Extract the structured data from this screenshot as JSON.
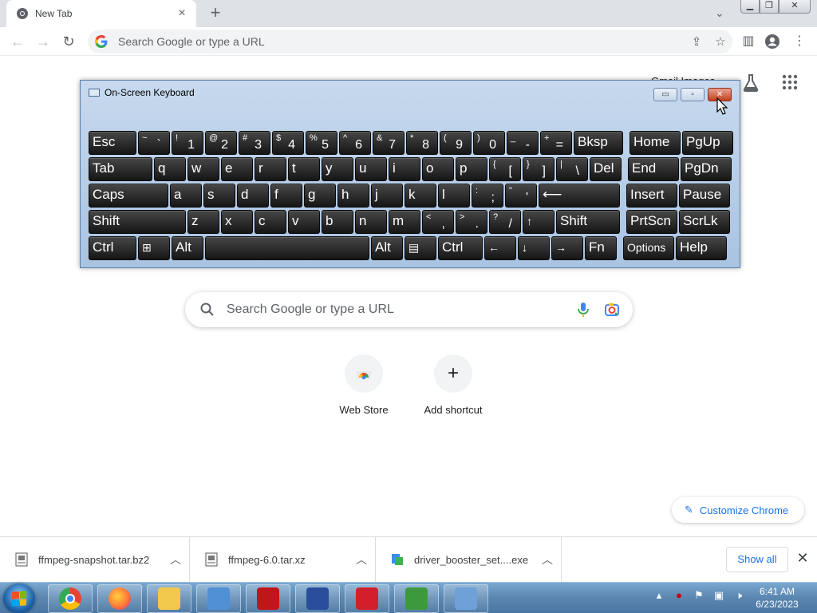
{
  "browser": {
    "tab": {
      "title": "New Tab",
      "close": "×"
    },
    "new_tab": "+",
    "tab_search": "⌄",
    "window_controls": {
      "minimize": "▁",
      "maximize": "❐",
      "close": "✕"
    },
    "nav": {
      "back": "←",
      "forward": "→",
      "reload": "↻"
    },
    "omnibox": {
      "placeholder": "Search Google or type a URL"
    }
  },
  "page": {
    "header_partial": "Gmail  Images",
    "search": {
      "placeholder": "Search Google or type a URL"
    },
    "shortcuts": [
      {
        "label": "Web Store"
      },
      {
        "label": "Add shortcut",
        "icon": "+"
      }
    ],
    "customize_label": "Customize Chrome"
  },
  "osk": {
    "title": "On-Screen Keyboard",
    "buttons": {
      "minimize": "▭",
      "restore": "▫",
      "close": "✕"
    },
    "rows": [
      [
        {
          "label": "Esc",
          "w": 60
        },
        {
          "top": "~",
          "bottom": "`",
          "w": 40
        },
        {
          "top": "!",
          "bottom": "1",
          "w": 40
        },
        {
          "top": "@",
          "bottom": "2",
          "w": 40
        },
        {
          "top": "#",
          "bottom": "3",
          "w": 40
        },
        {
          "top": "$",
          "bottom": "4",
          "w": 40
        },
        {
          "top": "%",
          "bottom": "5",
          "w": 40
        },
        {
          "top": "^",
          "bottom": "6",
          "w": 40
        },
        {
          "top": "&",
          "bottom": "7",
          "w": 40
        },
        {
          "top": "*",
          "bottom": "8",
          "w": 40
        },
        {
          "top": "(",
          "bottom": "9",
          "w": 40
        },
        {
          "top": ")",
          "bottom": "0",
          "w": 40
        },
        {
          "top": "_",
          "bottom": "-",
          "w": 40
        },
        {
          "top": "+",
          "bottom": "=",
          "w": 40
        },
        {
          "label": "Bksp",
          "w": 62,
          "gapAfter": 6
        },
        {
          "label": "Home",
          "w": 64
        },
        {
          "label": "PgUp",
          "w": 64
        }
      ],
      [
        {
          "label": "Tab",
          "w": 80
        },
        {
          "label": "q",
          "w": 40
        },
        {
          "label": "w",
          "w": 40
        },
        {
          "label": "e",
          "w": 40
        },
        {
          "label": "r",
          "w": 40
        },
        {
          "label": "t",
          "w": 40
        },
        {
          "label": "y",
          "w": 40
        },
        {
          "label": "u",
          "w": 40
        },
        {
          "label": "i",
          "w": 40
        },
        {
          "label": "o",
          "w": 40
        },
        {
          "label": "p",
          "w": 40
        },
        {
          "top": "{",
          "bottom": "[",
          "w": 40
        },
        {
          "top": "}",
          "bottom": "]",
          "w": 40
        },
        {
          "top": "|",
          "bottom": "\\",
          "w": 40
        },
        {
          "label": "Del",
          "w": 40,
          "gapAfter": 6
        },
        {
          "label": "End",
          "w": 64
        },
        {
          "label": "PgDn",
          "w": 64
        }
      ],
      [
        {
          "label": "Caps",
          "w": 100
        },
        {
          "label": "a",
          "w": 40
        },
        {
          "label": "s",
          "w": 40
        },
        {
          "label": "d",
          "w": 40
        },
        {
          "label": "f",
          "w": 40
        },
        {
          "label": "g",
          "w": 40
        },
        {
          "label": "h",
          "w": 40
        },
        {
          "label": "j",
          "w": 40
        },
        {
          "label": "k",
          "w": 40
        },
        {
          "label": "l",
          "w": 40
        },
        {
          "top": ":",
          "bottom": ";",
          "w": 40
        },
        {
          "top": "\"",
          "bottom": "'",
          "w": 40
        },
        {
          "label": "⟵",
          "w": 102,
          "gapAfter": 6
        },
        {
          "label": "Insert",
          "w": 64
        },
        {
          "label": "Pause",
          "w": 64
        }
      ],
      [
        {
          "label": "Shift",
          "w": 122
        },
        {
          "label": "z",
          "w": 40
        },
        {
          "label": "x",
          "w": 40
        },
        {
          "label": "c",
          "w": 40
        },
        {
          "label": "v",
          "w": 40
        },
        {
          "label": "b",
          "w": 40
        },
        {
          "label": "n",
          "w": 40
        },
        {
          "label": "m",
          "w": 40
        },
        {
          "top": "<",
          "bottom": ",",
          "w": 40
        },
        {
          "top": ">",
          "bottom": ".",
          "w": 40
        },
        {
          "top": "?",
          "bottom": "/",
          "w": 40
        },
        {
          "label": "↑",
          "w": 40,
          "small": true
        },
        {
          "label": "Shift",
          "w": 80,
          "gapAfter": 6
        },
        {
          "label": "PrtScn",
          "w": 64
        },
        {
          "label": "ScrLk",
          "w": 64
        }
      ],
      [
        {
          "label": "Ctrl",
          "w": 60
        },
        {
          "label": "⊞",
          "w": 40,
          "small": true
        },
        {
          "label": "Alt",
          "w": 40
        },
        {
          "label": "",
          "w": 206
        },
        {
          "label": "Alt",
          "w": 40
        },
        {
          "label": "▤",
          "w": 40,
          "small": true
        },
        {
          "label": "Ctrl",
          "w": 56
        },
        {
          "label": "←",
          "w": 40,
          "small": true
        },
        {
          "label": "↓",
          "w": 40,
          "small": true
        },
        {
          "label": "→",
          "w": 40,
          "small": true
        },
        {
          "label": "Fn",
          "w": 40,
          "gapAfter": 6
        },
        {
          "label": "Options",
          "w": 64,
          "small": true
        },
        {
          "label": "Help",
          "w": 64
        }
      ]
    ]
  },
  "downloads": {
    "items": [
      {
        "name": "ffmpeg-snapshot.tar.bz2"
      },
      {
        "name": "ffmpeg-6.0.tar.xz"
      },
      {
        "name": "driver_booster_set....exe"
      }
    ],
    "show_all": "Show all",
    "close": "✕"
  },
  "taskbar": {
    "apps": [
      {
        "name": "chrome",
        "color": "#e8e8e8"
      },
      {
        "name": "firefox",
        "color": "#ff7139"
      },
      {
        "name": "explorer",
        "color": "#f2c94c"
      },
      {
        "name": "control-panel",
        "color": "#4f8fd4"
      },
      {
        "name": "driver-booster",
        "color": "#c0161b"
      },
      {
        "name": "snipping",
        "color": "#2a4d9c"
      },
      {
        "name": "screen-recorder",
        "color": "#d21f2b"
      },
      {
        "name": "vim",
        "color": "#3c9a3c"
      },
      {
        "name": "osk",
        "color": "#6fa0d8"
      }
    ],
    "clock_time": "6:41 AM",
    "clock_date": "6/23/2023"
  },
  "colors": {
    "accent": "#1a73e8",
    "tabstrip": "#dee1e6",
    "key": "#1b1b1b"
  }
}
